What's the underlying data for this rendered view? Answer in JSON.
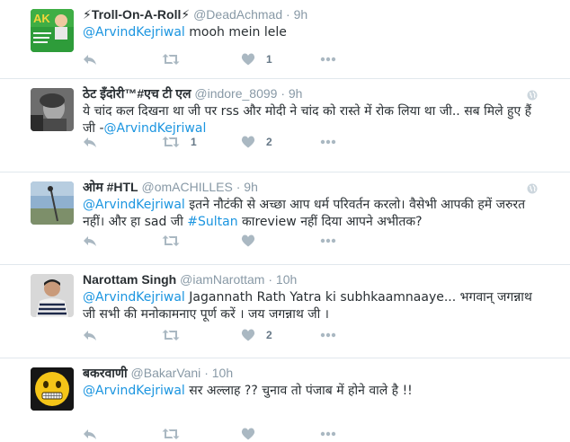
{
  "tweets": [
    {
      "fullname": "⚡Troll-On-A-Roll⚡",
      "username": "@DeadAchmad",
      "dot": "·",
      "time": "9h",
      "text_parts": [
        {
          "type": "mention",
          "text": "@ArvindKejriwal"
        },
        {
          "type": "text",
          "text": " mooh mein lele"
        }
      ],
      "retweets": "",
      "likes": "1",
      "has_globe": false
    },
    {
      "fullname": "ठेट इँदोरी™#एच टी एल",
      "username": "@indore_8099",
      "dot": "·",
      "time": "9h",
      "text_parts": [
        {
          "type": "text",
          "text": "ये चांद कल दिखना था जी पर rss और मोदी ने चांद को रास्ते में रोक लिया था जी.. सब मिले हुए हैं जी -"
        },
        {
          "type": "mention",
          "text": "@ArvindKejriwal"
        }
      ],
      "retweets": "1",
      "likes": "2",
      "has_globe": true
    },
    {
      "fullname": "ओम #HTL",
      "username": "@omACHILLES",
      "dot": "·",
      "time": "9h",
      "text_parts": [
        {
          "type": "mention",
          "text": "@ArvindKejriwal"
        },
        {
          "type": "text",
          "text": " इतने नौटंकी से अच्छा आप धर्म परिवर्तन करलो। वैसेभी आपकी हमें जरुरत नहीं। और हा sad जी "
        },
        {
          "type": "hashtag",
          "text": "#Sultan"
        },
        {
          "type": "text",
          "text": " काreview नहीं दिया आपने अभीतक?"
        }
      ],
      "retweets": "",
      "likes": "",
      "has_globe": true
    },
    {
      "fullname": "Narottam Singh",
      "username": "@iamNarottam",
      "dot": "·",
      "time": "10h",
      "text_parts": [
        {
          "type": "mention",
          "text": "@ArvindKejriwal"
        },
        {
          "type": "text",
          "text": " Jagannath Rath Yatra ki subhkaamnaaye... भगवान् जगन्नाथ जी सभी की मनोकामनाए पूर्ण करें । जय जगन्नाथ जी ।"
        }
      ],
      "retweets": "",
      "likes": "2",
      "has_globe": false
    },
    {
      "fullname": "बकरवाणी",
      "username": "@BakarVani",
      "dot": "·",
      "time": "10h",
      "text_parts": [
        {
          "type": "mention",
          "text": "@ArvindKejriwal"
        },
        {
          "type": "text",
          "text": " सर अल्लाह ?? चुनाव तो पंजाब में होने वाले है !!"
        }
      ],
      "retweets": "",
      "likes": "",
      "has_globe": false
    }
  ],
  "icons": {
    "reply": "reply-icon",
    "retweet": "retweet-icon",
    "like": "heart-icon",
    "more": "more-dots-icon",
    "globe": "globe-icon"
  },
  "colors": {
    "link": "#1b95e0",
    "muted": "#8899a6",
    "action": "#aab8c2",
    "divider": "#e1e8ed"
  }
}
